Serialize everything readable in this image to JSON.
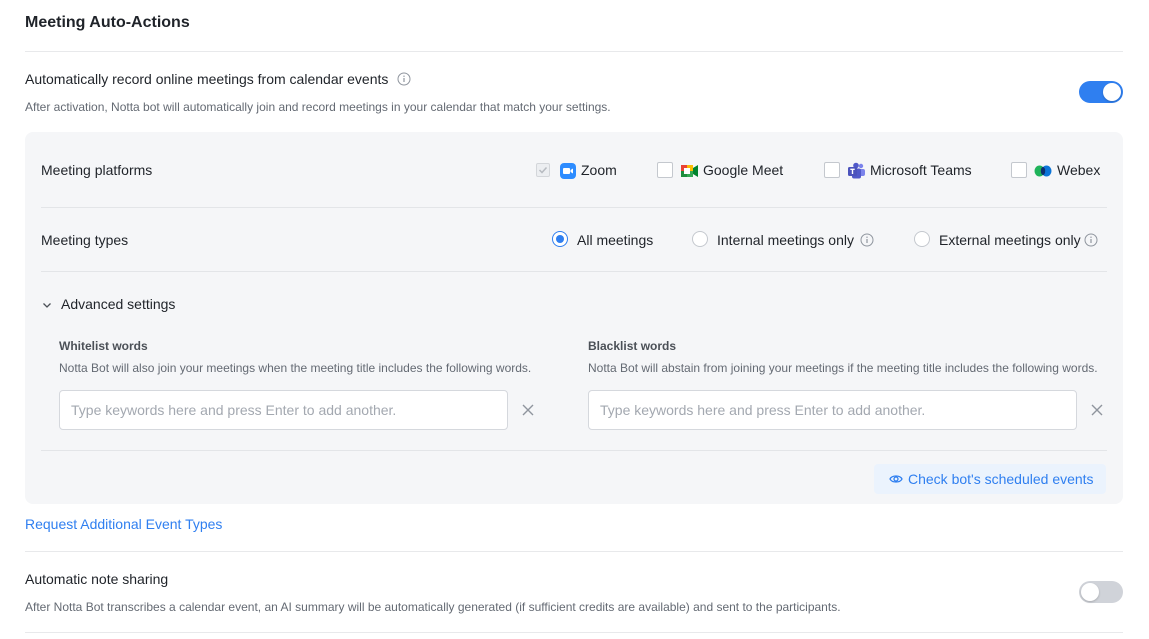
{
  "section_title": "Meeting Auto-Actions",
  "auto_record": {
    "title": "Automatically record online meetings from calendar events",
    "description": "After activation, Notta bot will automatically join and record meetings in your calendar that match your settings.",
    "enabled": true
  },
  "platforms": {
    "label": "Meeting platforms",
    "items": [
      {
        "name": "Zoom",
        "checked": true,
        "icon": "zoom-icon"
      },
      {
        "name": "Google Meet",
        "checked": false,
        "icon": "google-meet-icon"
      },
      {
        "name": "Microsoft Teams",
        "checked": false,
        "icon": "microsoft-teams-icon"
      },
      {
        "name": "Webex",
        "checked": false,
        "icon": "webex-icon"
      }
    ]
  },
  "meeting_types": {
    "label": "Meeting types",
    "options": [
      {
        "label": "All meetings",
        "selected": true
      },
      {
        "label": "Internal meetings only",
        "selected": false
      },
      {
        "label": "External meetings only",
        "selected": false
      }
    ]
  },
  "advanced": {
    "label": "Advanced settings",
    "expanded": true,
    "whitelist": {
      "title": "Whitelist words",
      "description": "Notta Bot will also join your meetings when the meeting title includes the following words.",
      "placeholder": "Type keywords here and press Enter to add another.",
      "value": ""
    },
    "blacklist": {
      "title": "Blacklist words",
      "description": "Notta Bot will abstain from joining your meetings if the meeting title includes the following words.",
      "placeholder": "Type keywords here and press Enter to add another.",
      "value": ""
    }
  },
  "check_button": "Check bot's scheduled events",
  "request_link": "Request Additional Event Types",
  "note_sharing": {
    "title": "Automatic note sharing",
    "description": "After Notta Bot transcribes a calendar event, an AI summary will be automatically generated (if sufficient credits are available) and sent to the participants.",
    "enabled": false
  },
  "colors": {
    "accent": "#2f7ff0",
    "panel_bg": "#f5f6f8",
    "toggle_off": "#d0d3d9"
  }
}
